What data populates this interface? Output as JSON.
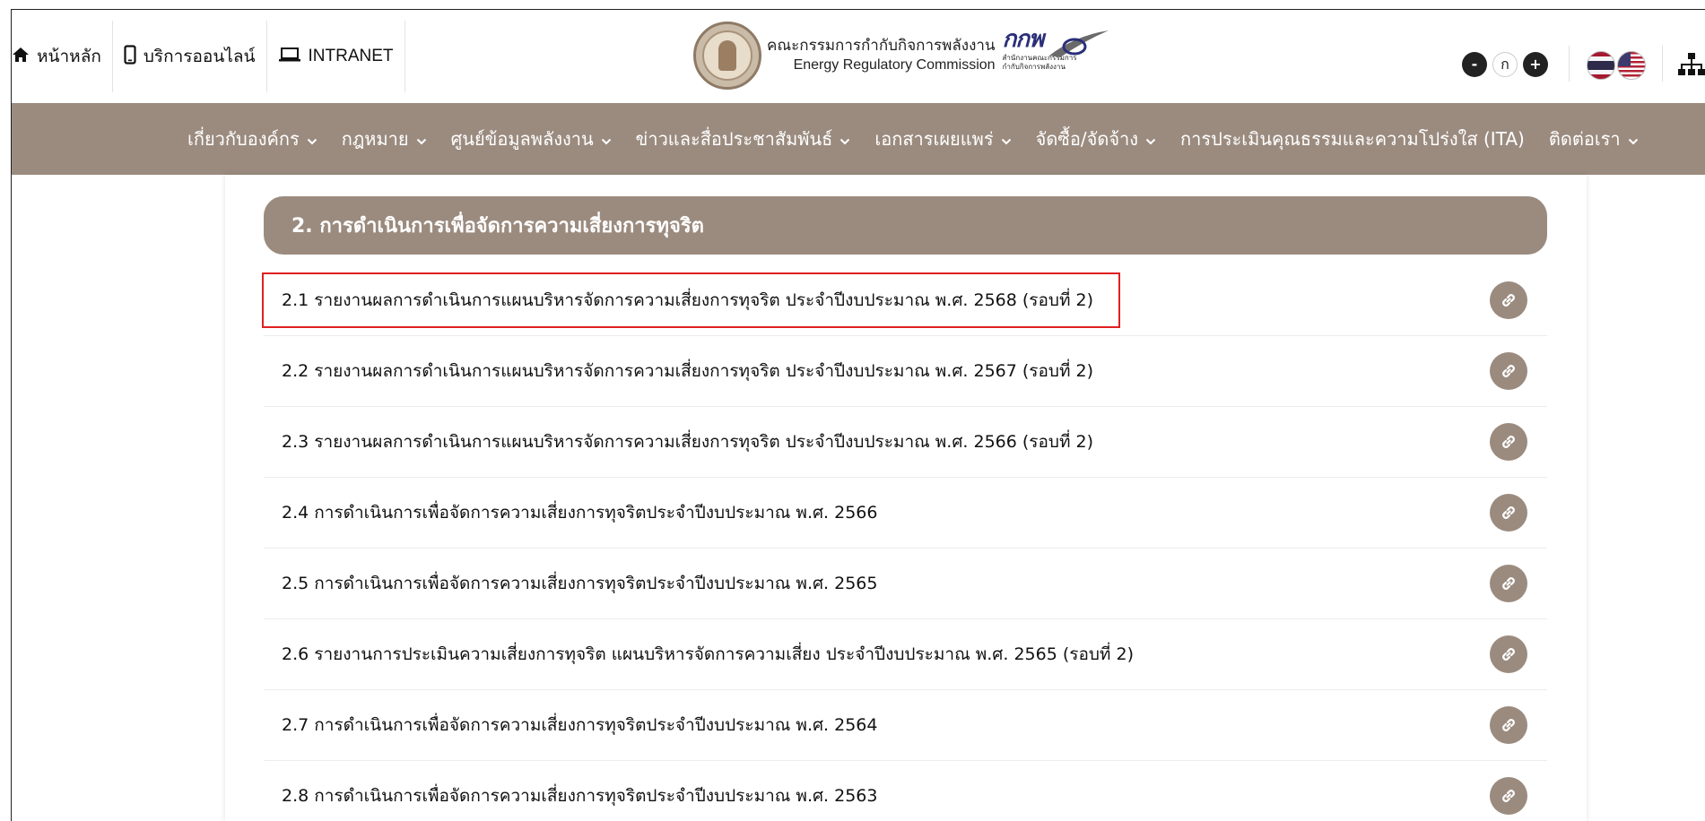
{
  "top_links": [
    {
      "label": "หน้าหลัก",
      "icon": "home-icon"
    },
    {
      "label": "บริการออนไลน์",
      "icon": "mobile-icon"
    },
    {
      "label": "INTRANET",
      "icon": "laptop-icon"
    }
  ],
  "logo": {
    "th": "คณะกรรมการกำกับกิจการพลังงาน",
    "en": "Energy Regulatory Commission",
    "mark": "กกพ",
    "sub1": "สำนักงานคณะกรรมการ",
    "sub2": "กำกับกิจการพลังงาน"
  },
  "font_controls": {
    "decrease": "-",
    "normal": "ก",
    "increase": "+"
  },
  "languages": [
    "th-flag-icon",
    "us-flag-icon"
  ],
  "nav": [
    {
      "label": "เกี่ยวกับองค์กร",
      "dropdown": true
    },
    {
      "label": "กฎหมาย",
      "dropdown": true
    },
    {
      "label": "ศูนย์ข้อมูลพลังงาน",
      "dropdown": true
    },
    {
      "label": "ข่าวและสื่อประชาสัมพันธ์",
      "dropdown": true
    },
    {
      "label": "เอกสารเผยแพร่",
      "dropdown": true
    },
    {
      "label": "จัดซื้อ/จัดจ้าง",
      "dropdown": true
    },
    {
      "label": "การประเมินคุณธรรมและความโปร่งใส (ITA)",
      "dropdown": false
    },
    {
      "label": "ติดต่อเรา",
      "dropdown": true
    }
  ],
  "section": {
    "title": "2. การดำเนินการเพื่อจัดการความเสี่ยงการทุจริต",
    "items": [
      {
        "label": "2.1 รายงานผลการดำเนินการแผนบริหารจัดการความเสี่ยงการทุจริต ประจำปีงบประมาณ พ.ศ. 2568 (รอบที่ 2)",
        "highlighted": true
      },
      {
        "label": "2.2 รายงานผลการดำเนินการแผนบริหารจัดการความเสี่ยงการทุจริต ประจำปีงบประมาณ พ.ศ. 2567 (รอบที่ 2)",
        "highlighted": false
      },
      {
        "label": "2.3 รายงานผลการดำเนินการแผนบริหารจัดการความเสี่ยงการทุจริต ประจำปีงบประมาณ พ.ศ. 2566 (รอบที่ 2)",
        "highlighted": false
      },
      {
        "label": "2.4 การดำเนินการเพื่อจัดการความเสี่ยงการทุจริตประจำปีงบประมาณ พ.ศ. 2566",
        "highlighted": false
      },
      {
        "label": "2.5 การดำเนินการเพื่อจัดการความเสี่ยงการทุจริตประจำปีงบประมาณ พ.ศ. 2565",
        "highlighted": false
      },
      {
        "label": "2.6 รายงานการประเมินความเสี่ยงการทุจริต แผนบริหารจัดการความเสี่ยง ประจำปีงบประมาณ พ.ศ. 2565 (รอบที่ 2)",
        "highlighted": false
      },
      {
        "label": "2.7 การดำเนินการเพื่อจัดการความเสี่ยงการทุจริตประจำปีงบประมาณ พ.ศ. 2564",
        "highlighted": false
      },
      {
        "label": "2.8 การดำเนินการเพื่อจัดการความเสี่ยงการทุจริตประจำปีงบประมาณ พ.ศ. 2563",
        "highlighted": false
      }
    ]
  },
  "colors": {
    "accent": "#9b8b7f",
    "highlight_border": "#e02020"
  }
}
